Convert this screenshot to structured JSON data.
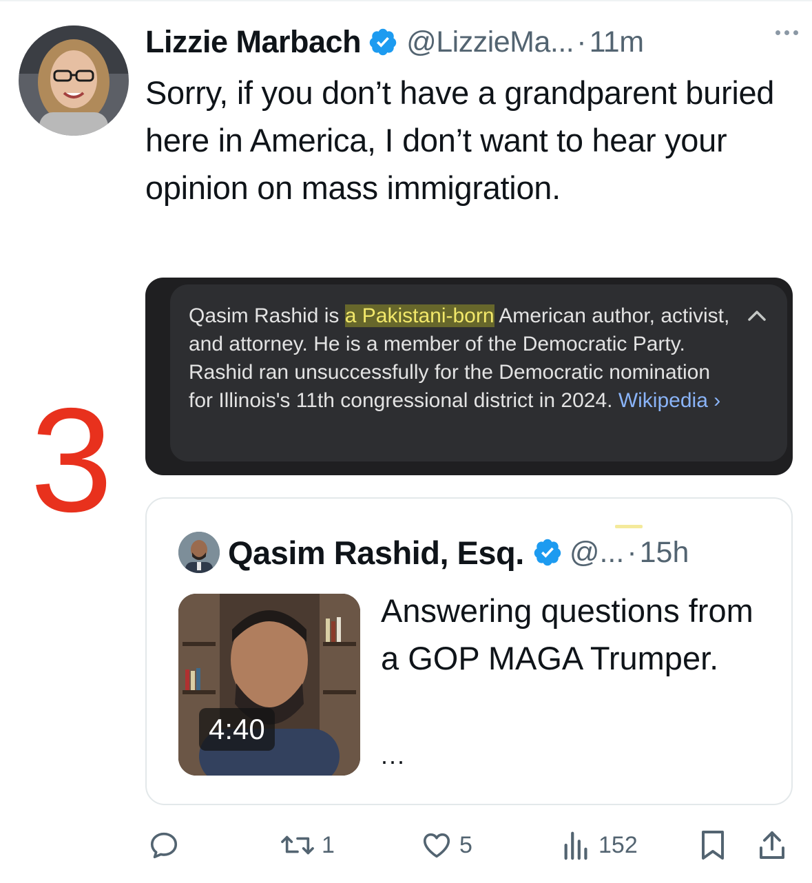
{
  "tweet": {
    "display_name": "Lizzie Marbach",
    "handle": "@LizzieMa...",
    "separator": "·",
    "time": "11m",
    "text": "Sorry, if you don’t have a grandparent buried here in America, I don’t want to hear your opinion on mass immigration."
  },
  "annotation": {
    "number": "3",
    "color": "#e8311d"
  },
  "media_card": {
    "text_before_highlight": "Qasim Rashid is ",
    "highlight": "a Pakistani-born",
    "text_after_highlight": " American author, activist, and attorney. He is a member of the Democratic Party. Rashid ran unsuccessfully for the Democratic nomination for Illinois's 11th congressional district in 2024. ",
    "link": "Wikipedia ›"
  },
  "quoted_tweet": {
    "display_name": "Qasim Rashid, Esq.",
    "handle": "@...",
    "separator": "·",
    "time": "15h",
    "video_duration": "4:40",
    "text": "Answering questions from a GOP MAGA Trumper.",
    "ellipsis": "..."
  },
  "actions": {
    "reply_count": "",
    "retweet_count": "1",
    "like_count": "5",
    "views_count": "152"
  },
  "colors": {
    "verified_blue": "#1d9bf0",
    "secondary_text": "#536471",
    "link_blue": "#8ab4f8"
  }
}
